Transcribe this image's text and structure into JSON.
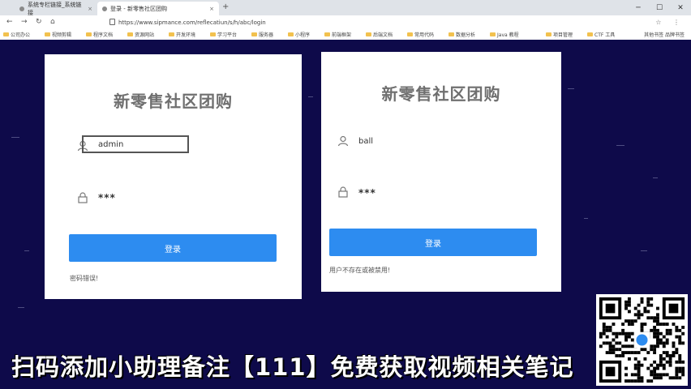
{
  "browser": {
    "tabs": [
      {
        "label": "系统专栏链接_系统链接",
        "active": false
      },
      {
        "label": "登录 - 新零售社区团购",
        "active": true
      }
    ],
    "new_tab_label": "+",
    "window_controls": [
      "─",
      "☐",
      "✕"
    ],
    "url": "https://www.sipmance.com/reflecatiun/s/h/abc/login",
    "bookmarks": [
      "公司办公",
      "视频剪辑",
      "程序文档",
      "资源网站",
      "开发环境",
      "学习平台",
      "服务器",
      "小程序",
      "前端框架",
      "后端文档",
      "常用代码",
      "数据分析",
      "Java 教程",
      "项目管理",
      "CTF 工具"
    ],
    "other_bookmarks": "其他书签 品牌书签"
  },
  "left_card": {
    "logo_text": "新零售社区团购",
    "username_value": "admin",
    "password_value": "***",
    "login_button": "登录",
    "note": "密码错误!"
  },
  "right_card": {
    "logo_text": "新零售社区团购",
    "username_value": "ball",
    "password_value": "***",
    "login_button": "登录",
    "note": "用户不存在或被禁用!"
  },
  "caption": "扫码添加小助理备注【111】免费获取视频相关笔记",
  "colors": {
    "background": "#0e0a4a",
    "button": "#2d8cf0",
    "logo": "#6f6f6f"
  }
}
